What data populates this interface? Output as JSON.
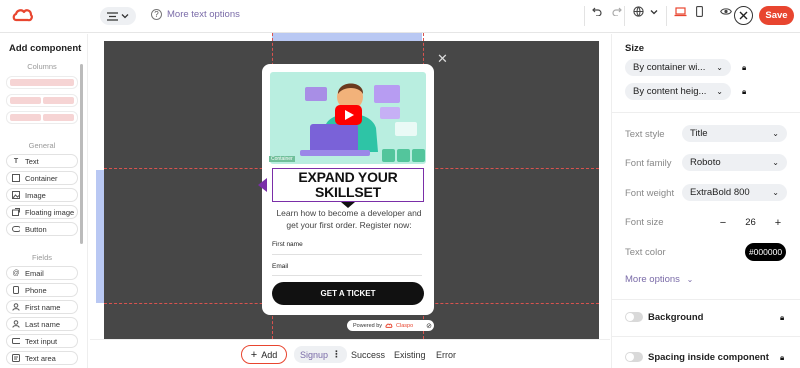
{
  "topbar": {
    "more_text_options": "More text options",
    "save_label": "Save",
    "brand_color": "#e8452f"
  },
  "left_panel": {
    "title": "Add component",
    "sections": {
      "columns": "Columns",
      "general": "General",
      "fields": "Fields"
    },
    "general_items": [
      {
        "label": "Text",
        "icon": "text-icon"
      },
      {
        "label": "Container",
        "icon": "container-icon"
      },
      {
        "label": "Image",
        "icon": "image-icon"
      },
      {
        "label": "Floating image",
        "icon": "floating-image-icon"
      },
      {
        "label": "Button",
        "icon": "button-icon"
      }
    ],
    "field_items": [
      {
        "label": "Email",
        "icon": "at-icon"
      },
      {
        "label": "Phone",
        "icon": "phone-icon"
      },
      {
        "label": "First name",
        "icon": "user-icon"
      },
      {
        "label": "Last name",
        "icon": "user-icon"
      },
      {
        "label": "Text input",
        "icon": "input-icon"
      },
      {
        "label": "Text area",
        "icon": "textarea-icon"
      }
    ]
  },
  "popup": {
    "heading_line1": "EXPAND YOUR",
    "heading_line2": "SKILLSET",
    "description": "Learn how to become a developer and get your first order. Register now:",
    "field1_label": "First name",
    "field2_label": "Email",
    "cta_label": "GET A TICKET",
    "powered_by": "Powered by",
    "powered_brand": "Claspo",
    "container_tag": "Container"
  },
  "bottom_bar": {
    "add_label": "Add",
    "tabs": [
      "Signup",
      "Success",
      "Existing",
      "Error"
    ],
    "active_tab": "Signup"
  },
  "right_panel": {
    "size_title": "Size",
    "width_mode": "By container wi...",
    "height_mode": "By content heig...",
    "text_style_label": "Text style",
    "text_style_value": "Title",
    "font_family_label": "Font family",
    "font_family_value": "Roboto",
    "font_weight_label": "Font weight",
    "font_weight_value": "ExtraBold 800",
    "font_size_label": "Font size",
    "font_size_value": "26",
    "text_color_label": "Text color",
    "text_color_value": "#000000",
    "more_options": "More options",
    "background_label": "Background",
    "spacing_label": "Spacing inside component",
    "link_color": "#7a6ba8"
  }
}
